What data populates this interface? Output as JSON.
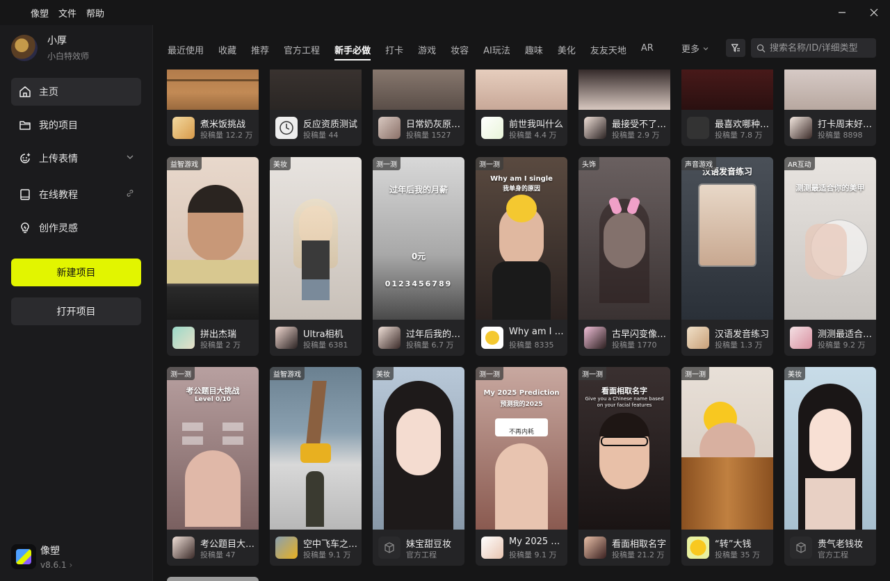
{
  "menu": [
    "像塑",
    "文件",
    "帮助"
  ],
  "user": {
    "name": "小厚",
    "role": "小白特效师"
  },
  "nav": [
    {
      "label": "主页",
      "icon": "home-icon"
    },
    {
      "label": "我的项目",
      "icon": "folder-icon"
    },
    {
      "label": "上传表情",
      "icon": "emoji-upload-icon"
    },
    {
      "label": "在线教程",
      "icon": "book-icon"
    },
    {
      "label": "创作灵感",
      "icon": "lightbulb-icon"
    }
  ],
  "buttons": {
    "new_project": "新建项目",
    "open_project": "打开项目"
  },
  "app": {
    "name": "像塑",
    "version": "v8.6.1"
  },
  "tabs": [
    "最近使用",
    "收藏",
    "推荐",
    "官方工程",
    "新手必做",
    "打卡",
    "游戏",
    "妆容",
    "AI玩法",
    "趣味",
    "美化",
    "友友天地",
    "AR"
  ],
  "more_label": "更多",
  "search": {
    "placeholder": "搜索名称/ID/详细类型"
  },
  "row1": [
    {
      "title": "煮米饭挑战",
      "sub": "投稿量 12.2 万"
    },
    {
      "title": "反应资质测试",
      "sub": "投稿量 44"
    },
    {
      "title": "日常奶灰原相...",
      "sub": "投稿量 1527"
    },
    {
      "title": "前世我叫什么",
      "sub": "投稿量 4.4 万"
    },
    {
      "title": "最接受不了男...",
      "sub": "投稿量 2.9 万"
    },
    {
      "title": "最喜欢哪种中...",
      "sub": "投稿量 7.8 万"
    },
    {
      "title": "打卡周末好心...",
      "sub": "投稿量 8898"
    }
  ],
  "row2": [
    {
      "badge": "益智游戏",
      "title": "拼出杰瑞",
      "sub": "投稿量 2 万"
    },
    {
      "badge": "美妆",
      "title": "Ultra相机",
      "sub": "投稿量 6381"
    },
    {
      "badge": "测一测",
      "title": "过年后我的月...",
      "sub": "投稿量 6.7 万"
    },
    {
      "badge": "测一测",
      "title": "Why am I si...",
      "sub": "投稿量 8335"
    },
    {
      "badge": "头饰",
      "title": "古早闪变像素...",
      "sub": "投稿量 1770"
    },
    {
      "badge": "声音游戏",
      "title": "汉语发音练习",
      "sub": "投稿量 1.3 万"
    },
    {
      "badge": "AR互动",
      "title": "测测最适合你...",
      "sub": "投稿量 9.2 万"
    }
  ],
  "row3": [
    {
      "badge": "测一测",
      "title": "考公题目大挑...",
      "sub": "投稿量 47"
    },
    {
      "badge": "益智游戏",
      "title": "空中飞车之吊...",
      "sub": "投稿量 9.1 万"
    },
    {
      "badge": "美妆",
      "title": "妹宝甜豆妆",
      "sub": "官方工程"
    },
    {
      "badge": "测一测",
      "title": "My 2025 Pre...",
      "sub": "投稿量 9.1 万"
    },
    {
      "badge": "测一测",
      "title": "看面相取名字",
      "sub": "投稿量 21.2 万"
    },
    {
      "badge": "测一测",
      "title": "“转”大钱",
      "sub": "投稿量 35 万"
    },
    {
      "badge": "美妆",
      "title": "贵气老钱妆",
      "sub": "官方工程"
    }
  ],
  "thumb_text": {
    "r2c3_title": "过年后我的月薪",
    "r2c3_value": "0元",
    "r2c3_digits": "0123456789",
    "r2c4_title": "Why am I single",
    "r2c4_sub": "我单身的原因",
    "r2c6_title": "汉语发音练习",
    "r2c7_title": "测测最适合你的美甲",
    "r3c1_title": "考公题目大挑战",
    "r3c1_level": "Level 0/10",
    "r3c4_title": "My 2025 Prediction",
    "r3c4_sub": "预测我的2025",
    "r3c4_bubble": "不再内耗",
    "r3c5_title": "看面相取名字",
    "r3c5_sub": "Give you a Chinese name based on your facial features"
  }
}
